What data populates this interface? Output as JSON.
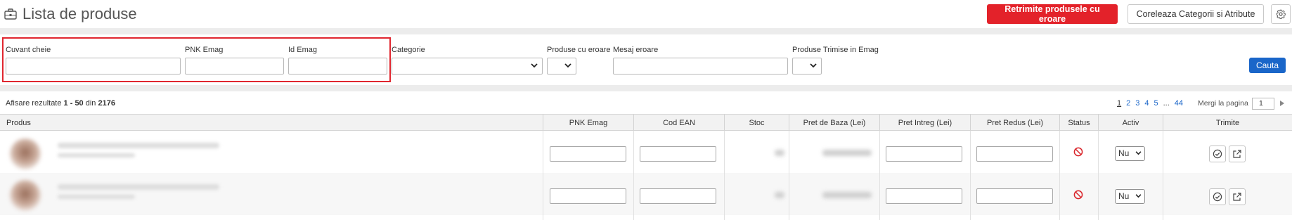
{
  "header": {
    "title": "Lista de produse",
    "title_icon": "briefcase-icon",
    "retrimite_label": "Retrimite produsele cu eroare",
    "coreleaza_label": "Coreleaza Categorii si Atribute",
    "settings_icon": "gear-icon"
  },
  "filters": {
    "cuvant_cheie": {
      "label": "Cuvant cheie",
      "value": ""
    },
    "pnk_emag": {
      "label": "PNK Emag",
      "value": ""
    },
    "id_emag": {
      "label": "Id Emag",
      "value": ""
    },
    "categorie": {
      "label": "Categorie",
      "value": ""
    },
    "produse_cu_eroare": {
      "label": "Produse cu eroare",
      "value": ""
    },
    "mesaj_eroare": {
      "label": "Mesaj eroare",
      "value": ""
    },
    "produse_trimise": {
      "label": "Produse Trimise in Emag",
      "value": ""
    },
    "search_label": "Cauta"
  },
  "results": {
    "prefix": "Afisare rezultate",
    "range": "1 - 50",
    "din": "din",
    "total": "2176"
  },
  "pagination": {
    "pages": [
      "1",
      "2",
      "3",
      "4",
      "5"
    ],
    "current": "1",
    "dots": "...",
    "last": "44",
    "per_page_label": "Mergi la pagina",
    "page_input": "1"
  },
  "table": {
    "columns": {
      "produs": "Produs",
      "pnk_emag": "PNK Emag",
      "cod_ean": "Cod EAN",
      "stoc": "Stoc",
      "pret_baza": "Pret de Baza (Lei)",
      "pret_intreg": "Pret Intreg (Lei)",
      "pret_redus": "Pret Redus (Lei)",
      "status": "Status",
      "activ": "Activ",
      "trimite": "Trimite"
    },
    "rows": [
      {
        "activ": "Nu",
        "status_icon": "ban-icon"
      },
      {
        "activ": "Nu",
        "status_icon": "ban-icon"
      }
    ]
  },
  "colors": {
    "primary_red": "#e3222a",
    "primary_blue": "#1a66c9",
    "highlight_border": "#e0262f"
  }
}
